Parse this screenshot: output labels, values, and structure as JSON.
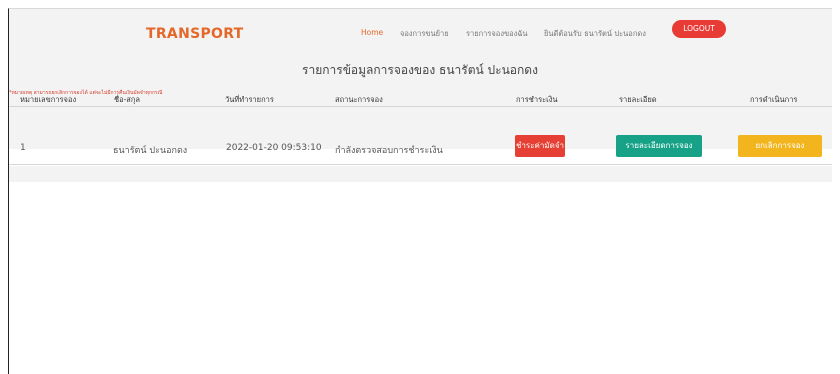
{
  "brand": "TRANSPORT",
  "nav": {
    "home": "Home",
    "item1": "จองการขนย้าย",
    "item2": "รายการจองของฉัน",
    "item3": "ยินดีต้อนรับ ธนารัตน์ ปะนอกดง",
    "logout": "LOGOUT"
  },
  "page_title": "รายการข้อมูลการจองของ ธนารัตน์ ปะนอกดง",
  "notice": "*หมายเหตุ สามารถยกเลิกการจองได้ แต่จะไม่มีการคืนเงินมัดจำทุกกรณี",
  "table": {
    "headers": [
      "หมายเลขการจอง",
      "ชื่อ-สกุล",
      "วันที่ทำรายการ",
      "สถานะการจอง",
      "การชำระเงิน",
      "รายละเอียด",
      "การดำเนินการ"
    ],
    "rows": [
      {
        "id": "1",
        "name": "ธนารัตน์ ปะนอกดง",
        "date": "2022-01-20 09:53:10",
        "status": "กำลังตรวจสอบการชำระเงิน",
        "pay_button": "ชำระค่ามัดจำ",
        "detail_button": "รายละเอียดการจอง",
        "cancel_button": "ยกเลิกการจอง"
      }
    ]
  }
}
